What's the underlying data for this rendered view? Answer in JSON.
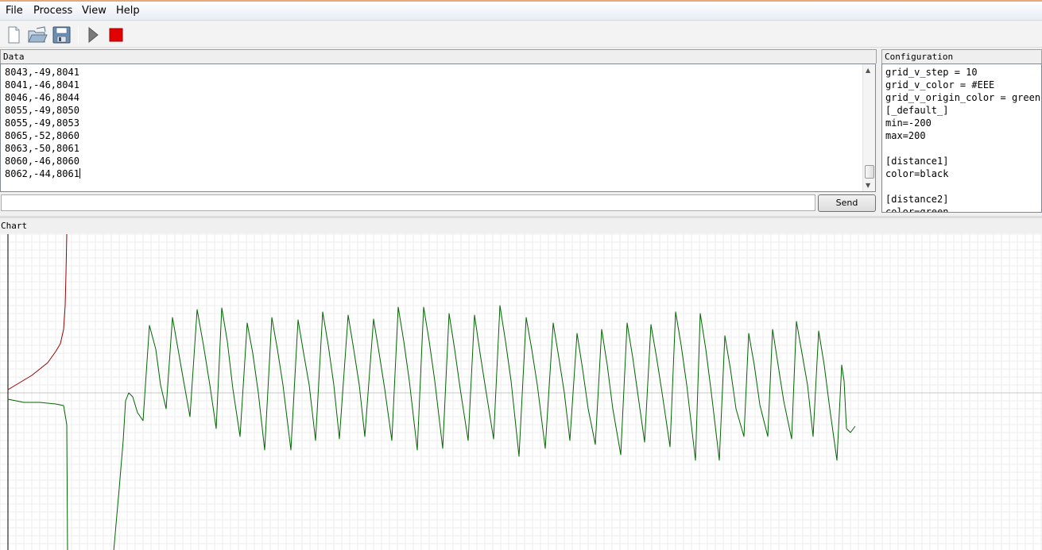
{
  "menu": [
    "File",
    "Process",
    "View",
    "Help"
  ],
  "toolbar": {
    "icons": [
      "new-file-icon",
      "open-folder-icon",
      "save-icon",
      "play-icon",
      "stop-icon"
    ],
    "stop_color": "#e30000"
  },
  "data_panel": {
    "title": "Data",
    "lines": [
      "8043,-49,8041",
      "8041,-46,8041",
      "8046,-46,8044",
      "8055,-49,8050",
      "8055,-49,8053",
      "8065,-52,8060",
      "8063,-50,8061",
      "8060,-46,8060",
      "8062,-44,8061"
    ]
  },
  "send": {
    "input_value": "",
    "button_label": "Send"
  },
  "config_panel": {
    "title": "Configuration",
    "lines": [
      "grid_v_step = 10",
      "grid_v_color = #EEE",
      "grid_v_origin_color = green",
      "[_default_]",
      "min=-200",
      "max=200",
      "",
      "[distance1]",
      "color=black",
      "",
      "[distance2]",
      "color=green"
    ]
  },
  "chart_panel": {
    "title": "Chart"
  },
  "chart_data": {
    "type": "line",
    "ylim": [
      -200,
      200
    ],
    "grid": true,
    "grid_color": "#eeeeee",
    "origin_color": "#c8c8c8",
    "series": [
      {
        "color": "#000000",
        "points": [
          [
            0,
            200
          ],
          [
            0,
            -200
          ]
        ]
      },
      {
        "color": "#990000",
        "points": [
          [
            0,
            4
          ],
          [
            10,
            10
          ],
          [
            20,
            16
          ],
          [
            30,
            22
          ],
          [
            40,
            30
          ],
          [
            50,
            38
          ],
          [
            60,
            52
          ],
          [
            66,
            62
          ],
          [
            70,
            80
          ],
          [
            72,
            110
          ],
          [
            73,
            150
          ],
          [
            74,
            200
          ]
        ]
      },
      {
        "color": "#006600",
        "points": [
          [
            0,
            -8
          ],
          [
            20,
            -12
          ],
          [
            40,
            -12
          ],
          [
            60,
            -14
          ],
          [
            70,
            -16
          ],
          [
            74,
            -40
          ],
          [
            75,
            -200
          ],
          [
            133,
            -200
          ],
          [
            140,
            -120
          ],
          [
            145,
            -60
          ],
          [
            148,
            -10
          ],
          [
            152,
            0
          ],
          [
            157,
            -5
          ],
          [
            163,
            -25
          ],
          [
            170,
            -35
          ],
          [
            178,
            85
          ],
          [
            186,
            55
          ],
          [
            192,
            10
          ],
          [
            199,
            -20
          ],
          [
            207,
            95
          ],
          [
            214,
            55
          ],
          [
            221,
            15
          ],
          [
            229,
            -30
          ],
          [
            238,
            105
          ],
          [
            246,
            60
          ],
          [
            254,
            10
          ],
          [
            262,
            -45
          ],
          [
            269,
            107
          ],
          [
            276,
            65
          ],
          [
            283,
            5
          ],
          [
            292,
            -55
          ],
          [
            301,
            88
          ],
          [
            308,
            50
          ],
          [
            315,
            0
          ],
          [
            323,
            -72
          ],
          [
            332,
            95
          ],
          [
            339,
            55
          ],
          [
            346,
            10
          ],
          [
            356,
            -72
          ],
          [
            365,
            92
          ],
          [
            372,
            50
          ],
          [
            379,
            10
          ],
          [
            387,
            -60
          ],
          [
            396,
            102
          ],
          [
            403,
            60
          ],
          [
            410,
            10
          ],
          [
            417,
            -58
          ],
          [
            428,
            98
          ],
          [
            435,
            55
          ],
          [
            442,
            10
          ],
          [
            449,
            -55
          ],
          [
            460,
            93
          ],
          [
            467,
            50
          ],
          [
            474,
            5
          ],
          [
            483,
            -60
          ],
          [
            491,
            108
          ],
          [
            498,
            65
          ],
          [
            505,
            15
          ],
          [
            515,
            -72
          ],
          [
            523,
            108
          ],
          [
            530,
            65
          ],
          [
            537,
            15
          ],
          [
            547,
            -70
          ],
          [
            555,
            100
          ],
          [
            562,
            55
          ],
          [
            569,
            5
          ],
          [
            579,
            -60
          ],
          [
            587,
            98
          ],
          [
            594,
            50
          ],
          [
            601,
            5
          ],
          [
            611,
            -58
          ],
          [
            619,
            110
          ],
          [
            626,
            65
          ],
          [
            633,
            15
          ],
          [
            643,
            -80
          ],
          [
            652,
            95
          ],
          [
            659,
            55
          ],
          [
            666,
            10
          ],
          [
            676,
            -70
          ],
          [
            686,
            88
          ],
          [
            693,
            45
          ],
          [
            700,
            0
          ],
          [
            707,
            -60
          ],
          [
            716,
            75
          ],
          [
            723,
            30
          ],
          [
            730,
            -20
          ],
          [
            739,
            -65
          ],
          [
            747,
            80
          ],
          [
            754,
            35
          ],
          [
            761,
            -20
          ],
          [
            771,
            -78
          ],
          [
            779,
            88
          ],
          [
            786,
            45
          ],
          [
            793,
            -5
          ],
          [
            801,
            -62
          ],
          [
            809,
            86
          ],
          [
            816,
            45
          ],
          [
            823,
            0
          ],
          [
            833,
            -68
          ],
          [
            840,
            102
          ],
          [
            847,
            60
          ],
          [
            854,
            10
          ],
          [
            865,
            -85
          ],
          [
            871,
            100
          ],
          [
            878,
            55
          ],
          [
            885,
            0
          ],
          [
            895,
            -85
          ],
          [
            902,
            72
          ],
          [
            909,
            30
          ],
          [
            916,
            -20
          ],
          [
            926,
            -55
          ],
          [
            932,
            75
          ],
          [
            939,
            35
          ],
          [
            946,
            -15
          ],
          [
            956,
            -55
          ],
          [
            962,
            80
          ],
          [
            969,
            35
          ],
          [
            976,
            -10
          ],
          [
            986,
            -58
          ],
          [
            992,
            90
          ],
          [
            999,
            50
          ],
          [
            1006,
            10
          ],
          [
            1013,
            -55
          ],
          [
            1020,
            78
          ],
          [
            1027,
            35
          ],
          [
            1034,
            -20
          ],
          [
            1043,
            -85
          ],
          [
            1049,
            35
          ],
          [
            1052,
            15
          ],
          [
            1055,
            -45
          ],
          [
            1060,
            -50
          ],
          [
            1066,
            -42
          ]
        ]
      }
    ]
  }
}
